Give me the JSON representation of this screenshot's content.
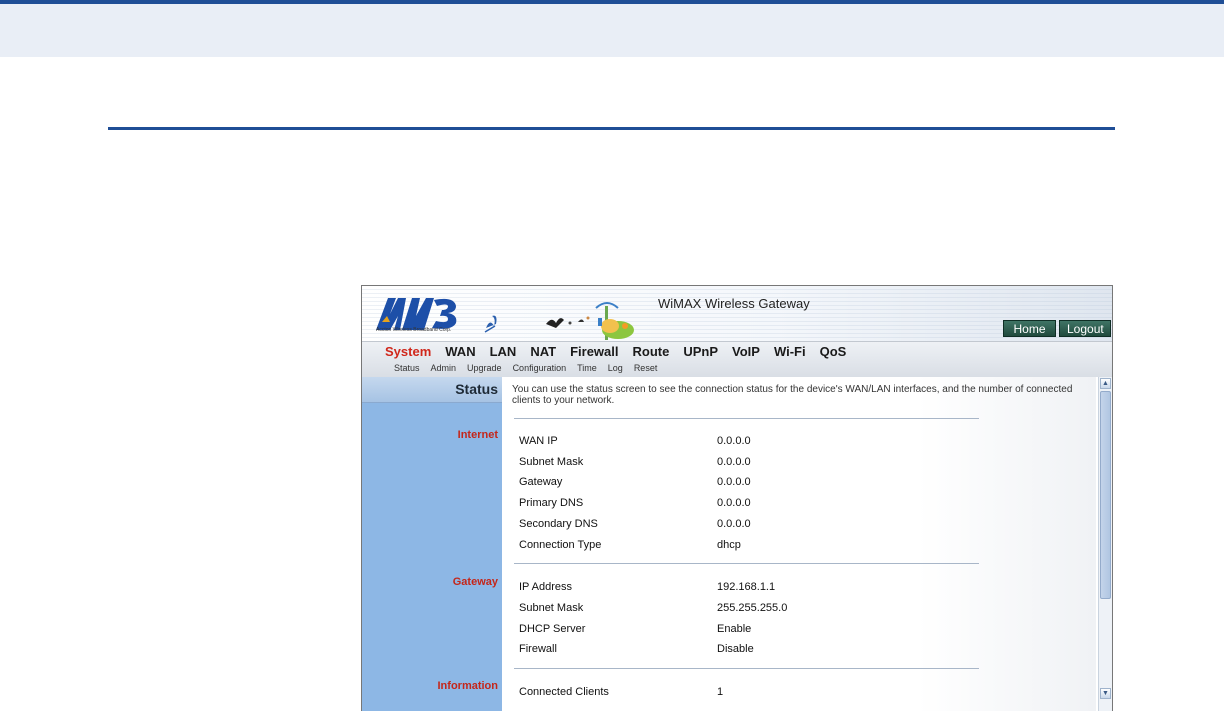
{
  "app": {
    "logo_text": "AW3",
    "logo_subtitle": "Accton Wireless Broadband Corp.",
    "title": "WiMAX Wireless Gateway",
    "home_label": "Home",
    "logout_label": "Logout"
  },
  "nav": {
    "main": [
      "System",
      "WAN",
      "LAN",
      "NAT",
      "Firewall",
      "Route",
      "UPnP",
      "VoIP",
      "Wi-Fi",
      "QoS"
    ],
    "active": "System",
    "sub": [
      "Status",
      "Admin",
      "Upgrade",
      "Configuration",
      "Time",
      "Log",
      "Reset"
    ]
  },
  "sidebar": {
    "heading": "Status",
    "sections": [
      "Internet",
      "Gateway",
      "Information"
    ]
  },
  "content": {
    "intro": "You can use the status screen to see the connection status for the device's WAN/LAN interfaces, and the number of connected clients to your network.",
    "internet": [
      {
        "label": "WAN IP",
        "value": "0.0.0.0"
      },
      {
        "label": "Subnet Mask",
        "value": "0.0.0.0"
      },
      {
        "label": "Gateway",
        "value": "0.0.0.0"
      },
      {
        "label": "Primary DNS",
        "value": "0.0.0.0"
      },
      {
        "label": "Secondary DNS",
        "value": "0.0.0.0"
      },
      {
        "label": "Connection Type",
        "value": "dhcp"
      }
    ],
    "gateway": [
      {
        "label": "IP Address",
        "value": "192.168.1.1"
      },
      {
        "label": "Subnet Mask",
        "value": "255.255.255.0"
      },
      {
        "label": "DHCP Server",
        "value": "Enable"
      },
      {
        "label": "Firewall",
        "value": "Disable"
      }
    ],
    "information": [
      {
        "label": "Connected Clients",
        "value": "1"
      }
    ]
  },
  "colors": {
    "accent_blue": "#1f4e96",
    "active_red": "#d0271b",
    "sidebar_blue": "#8db7e5"
  }
}
